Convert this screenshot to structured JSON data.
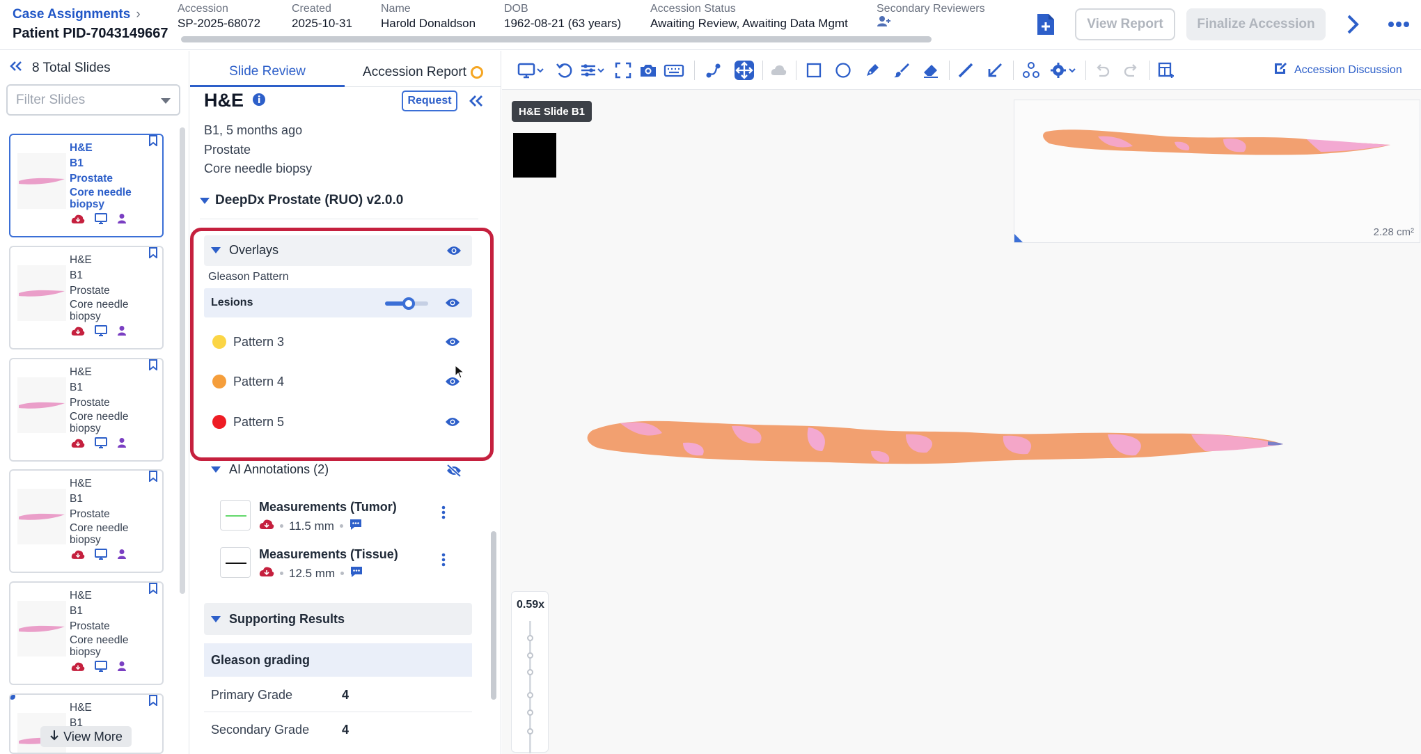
{
  "header": {
    "breadcrumb": "Case Assignments",
    "patient": "Patient PID-7043149667",
    "accession": {
      "label": "Accession",
      "value": "SP-2025-68072"
    },
    "created": {
      "label": "Created",
      "value": "2025-10-31"
    },
    "name": {
      "label": "Name",
      "value": "Harold Donaldson"
    },
    "dob": {
      "label": "DOB",
      "value": "1962-08-21 (63 years)"
    },
    "status": {
      "label": "Accession Status",
      "value": "Awaiting Review, Awaiting Data Mgmt"
    },
    "secondary": {
      "label": "Secondary Reviewers"
    },
    "view_report": "View Report",
    "finalize": "Finalize Accession"
  },
  "slide_list": {
    "total": "8 Total Slides",
    "filter_placeholder": "Filter Slides",
    "cards": [
      {
        "stain": "H&E",
        "block": "B1",
        "organ": "Prostate",
        "procedure": "Core needle biopsy"
      },
      {
        "stain": "H&E",
        "block": "B1",
        "organ": "Prostate",
        "procedure": "Core needle biopsy"
      },
      {
        "stain": "H&E",
        "block": "B1",
        "organ": "Prostate",
        "procedure": "Core needle biopsy"
      },
      {
        "stain": "H&E",
        "block": "B1",
        "organ": "Prostate",
        "procedure": "Core needle biopsy"
      },
      {
        "stain": "H&E",
        "block": "B1",
        "organ": "Prostate",
        "procedure": "Core needle biopsy"
      },
      {
        "stain": "H&E",
        "block": "B1"
      }
    ],
    "view_more": "View More"
  },
  "detail": {
    "tabs": {
      "slide_review": "Slide Review",
      "accession_report": "Accession Report"
    },
    "stain": "H&E",
    "request": "Request",
    "block_time": "B1, 5 months ago",
    "organ": "Prostate",
    "procedure": "Core needle biopsy",
    "algorithm": "DeepDx Prostate (RUO) v2.0.0",
    "overlays": {
      "title": "Overlays",
      "group": "Gleason Pattern",
      "lesions": "Lesions",
      "lesions_opacity": 0.55,
      "patterns": [
        {
          "label": "Pattern 3",
          "color": "#fbd545"
        },
        {
          "label": "Pattern 4",
          "color": "#f59e3b"
        },
        {
          "label": "Pattern 5",
          "color": "#ee1c24"
        }
      ]
    },
    "ai_annotations": {
      "title": "AI Annotations (2)",
      "items": [
        {
          "title": "Measurements (Tumor)",
          "value": "11.5 mm",
          "color": "#63d86b"
        },
        {
          "title": "Measurements (Tissue)",
          "value": "12.5 mm",
          "color": "#111111"
        }
      ]
    },
    "supporting": {
      "title": "Supporting Results",
      "gleason_grading": "Gleason grading",
      "primary": {
        "label": "Primary Grade",
        "value": "4"
      },
      "secondary": {
        "label": "Secondary Grade",
        "value": "4"
      }
    }
  },
  "viewer": {
    "accession_discussion": "Accession Discussion",
    "slide_label": "H&E Slide B1",
    "minimap_area": "2.28 cm²",
    "zoom": "0.59x"
  }
}
